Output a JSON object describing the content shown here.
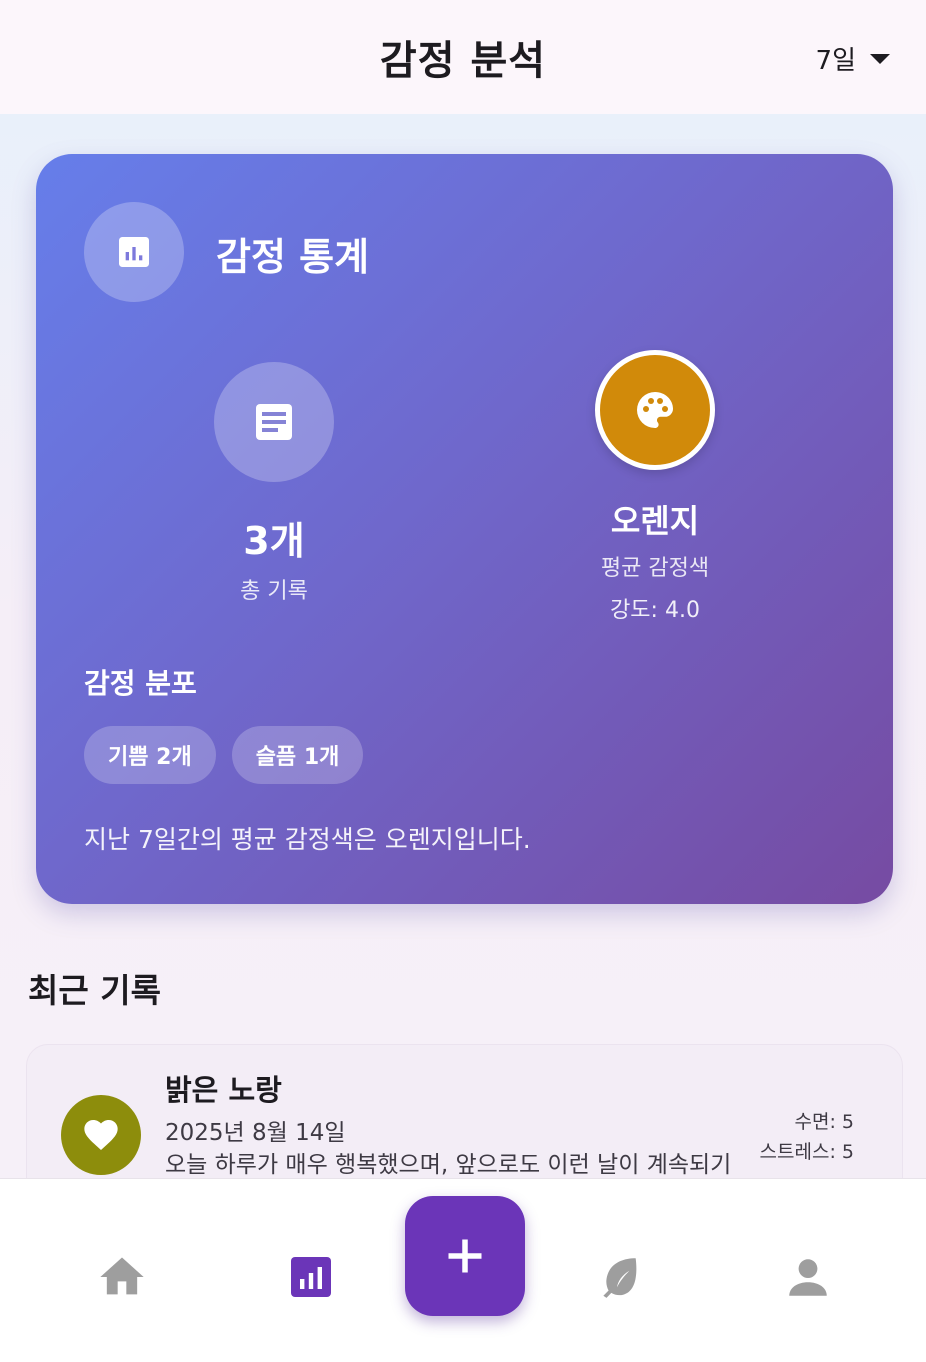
{
  "header": {
    "title": "감정 분석",
    "period_selected": "7일",
    "period_icon": "chevron-down-icon"
  },
  "stats_card": {
    "title": "감정 통계",
    "title_icon": "bar-chart-icon",
    "total": {
      "icon": "document-icon",
      "value": "3개",
      "label": "총 기록"
    },
    "average": {
      "icon": "palette-icon",
      "color_name": "오렌지",
      "color_hex": "#d18a0a",
      "label": "평균 감정색",
      "intensity": "강도: 4.0"
    },
    "distribution_title": "감정 분포",
    "distribution": [
      {
        "label": "기쁨 2개"
      },
      {
        "label": "슬픔 1개"
      }
    ],
    "summary": "지난 7일간의 평균 감정색은 오렌지입니다.",
    "gradient": [
      "#667eea",
      "#764ba2"
    ]
  },
  "recent": {
    "title": "최근 기록",
    "records": [
      {
        "color_name": "밝은 노랑",
        "color_hex": "#8d8d0c",
        "icon": "heart-icon",
        "date": "2025년 8월 14일",
        "note": "오늘 하루가 매우 행복했으며, 앞으로도 이런 날이 계속되기",
        "sleep": "수면: 5",
        "stress": "스트레스: 5"
      }
    ]
  },
  "bottom_nav": {
    "items": [
      {
        "icon": "home-icon",
        "active": false
      },
      {
        "icon": "bar-chart-icon",
        "active": true
      },
      {
        "icon": "leaf-icon",
        "active": false
      },
      {
        "icon": "person-icon",
        "active": false
      }
    ],
    "fab_icon": "plus-icon",
    "active_color": "#6b35b8",
    "inactive_color": "#9e9e9e"
  }
}
